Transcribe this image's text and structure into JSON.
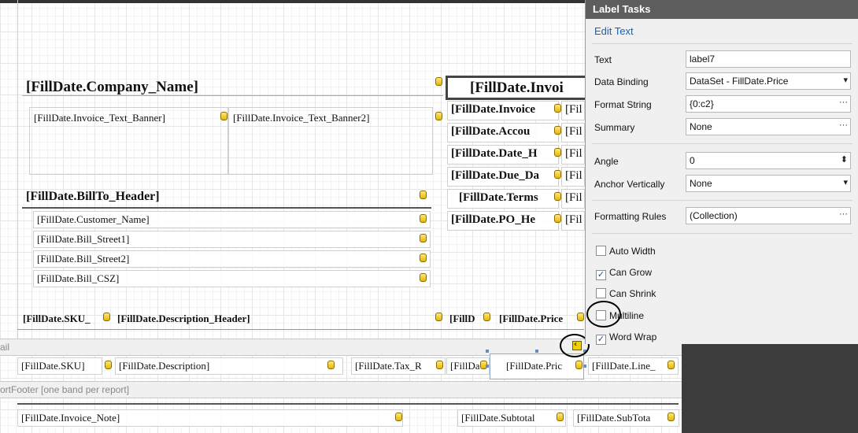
{
  "panel": {
    "title": "Label Tasks",
    "edit_text": "Edit Text",
    "props": {
      "text_label": "Text",
      "text_value": "label7",
      "binding_label": "Data Binding",
      "binding_value": "DataSet - FillDate.Price",
      "format_label": "Format String",
      "format_value": "{0:c2}",
      "summary_label": "Summary",
      "summary_value": "None",
      "angle_label": "Angle",
      "angle_value": "0",
      "anchor_label": "Anchor Vertically",
      "anchor_value": "None",
      "rules_label": "Formatting Rules",
      "rules_value": "(Collection)"
    },
    "checkboxes": {
      "auto_width": {
        "label": "Auto Width",
        "checked": false
      },
      "can_grow": {
        "label": "Can Grow",
        "checked": true
      },
      "can_shrink": {
        "label": "Can Shrink",
        "checked": false
      },
      "multiline": {
        "label": "Multiline",
        "checked": false
      },
      "word_wrap": {
        "label": "Word Wrap",
        "checked": true
      }
    },
    "glyphs": {
      "ellipsis": "···",
      "dropdown": "▾",
      "spin": "⬍",
      "check": "✓"
    }
  },
  "report": {
    "company_name": "[FillDate.Company_Name]",
    "invoice_title": "[FillDate.Invoi",
    "banner1": "[FillDate.Invoice_Text_Banner]",
    "banner2": "[FillDate.Invoice_Text_Banner2]",
    "inv_labels": [
      "[FillDate.Invoice",
      "[FillDate.Accou",
      "[FillDate.Date_H",
      "[FillDate.Due_Da",
      "[FillDate.Terms",
      "[FillDate.PO_He"
    ],
    "inv_values": [
      "[Fil",
      "[Fil",
      "[Fil",
      "[Fil",
      "[Fil",
      "[Fil"
    ],
    "billto_header": "[FillDate.BillTo_Header]",
    "bill_lines": [
      "[FillDate.Customer_Name]",
      "[FillDate.Bill_Street1]",
      "[FillDate.Bill_Street2]",
      "[FillDate.Bill_CSZ]"
    ],
    "header_sku": "[FillDate.SKU_",
    "header_desc": "[FillDate.Description_Header]",
    "header_filld": "[FillD",
    "header_price": "[FillDate.Price",
    "detail_band": "ail",
    "detail_sku": "[FillDate.SKU]",
    "detail_desc": "[FillDate.Description]",
    "detail_tax": "[FillDate.Tax_R",
    "detail_fillda": "[FillDa",
    "detail_price": "[FillDate.Pric",
    "detail_line": "[FillDate.Line_",
    "footer_band": "ortFooter [one band per report]",
    "invoice_note": "[FillDate.Invoice_Note]",
    "subtotal_label": "[FillDate.Subtotal",
    "subtotal_value": "[FillDate.SubTota"
  }
}
